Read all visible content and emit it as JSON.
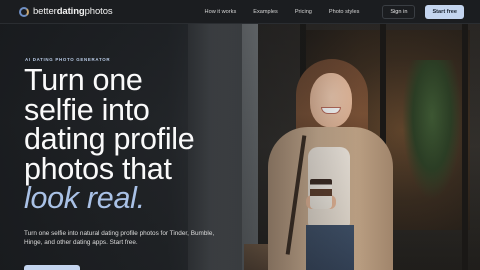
{
  "brand": {
    "name_light": "better",
    "name_bold": "dating",
    "name_end": "photos"
  },
  "nav": {
    "links": [
      "How it works",
      "Examples",
      "Pricing",
      "Photo styles"
    ],
    "signin_label": "Sign in",
    "cta_label": "Start free"
  },
  "hero": {
    "eyebrow": "AI DATING PHOTO GENERATOR",
    "headline_lines": [
      "Turn one",
      "selfie into",
      "dating profile",
      "photos that"
    ],
    "headline_accent": "look real.",
    "subtext": "Turn one selfie into natural dating profile photos for Tinder, Bumble, Hinge, and other dating apps. Start free."
  },
  "colors": {
    "accent": "#c4d5ef",
    "accent_text": "#a9c1e6",
    "nav_bg": "#1b1d20"
  },
  "icons": {
    "logo": "ring-logo-icon"
  }
}
